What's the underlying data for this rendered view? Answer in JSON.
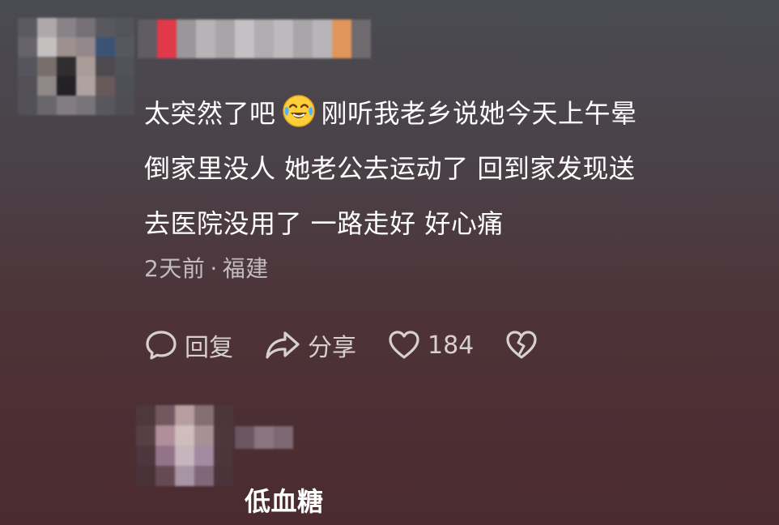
{
  "comment": {
    "text_part1": "太突然了吧",
    "emoji_icon": "crying-laughing-emoji",
    "text_line1_rest": "刚听我老乡说她今天上午晕",
    "text_line2": "倒家里没人 她老公去运动了 回到家发现送",
    "text_line3": "去医院没用了 一路走好 好心痛",
    "time": "2天前",
    "separator": "·",
    "location": "福建"
  },
  "actions": {
    "reply_label": "回复",
    "reply_icon": "chat-bubble-icon",
    "share_label": "分享",
    "share_icon": "share-arrow-icon",
    "like_count": "184",
    "like_icon": "heart-outline-icon",
    "dislike_icon": "broken-heart-icon"
  },
  "reply": {
    "text": "低血糖"
  },
  "colors": {
    "background_top": "#4a4b52",
    "background_bottom": "#4b2b2f",
    "text_primary": "#ffffff",
    "text_secondary": "#c2bcc0",
    "icon_color": "#d6d0d3"
  }
}
